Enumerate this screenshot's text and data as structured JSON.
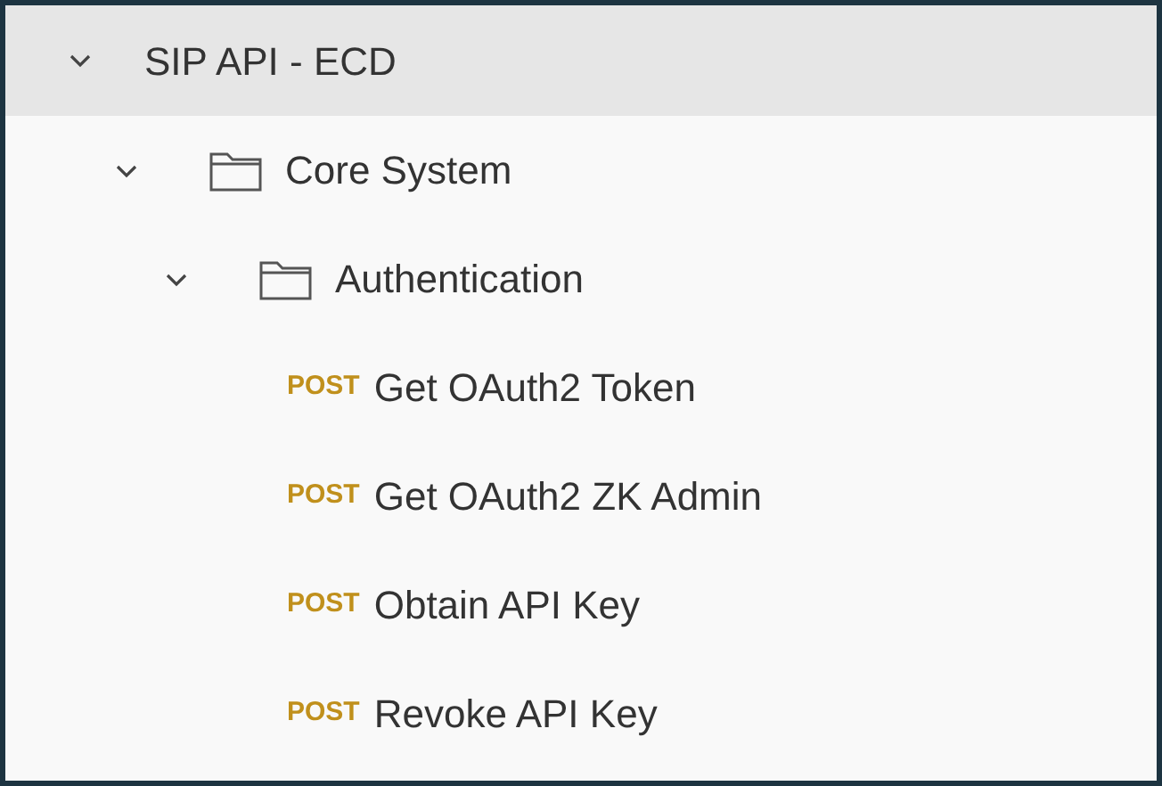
{
  "collection": {
    "name": "SIP API - ECD",
    "expanded": true,
    "selected": true,
    "children": [
      {
        "kind": "folder",
        "name": "Core System",
        "expanded": true,
        "children": [
          {
            "kind": "folder",
            "name": "Authentication",
            "expanded": true,
            "children": [
              {
                "kind": "request",
                "method": "POST",
                "name": "Get OAuth2 Token"
              },
              {
                "kind": "request",
                "method": "POST",
                "name": "Get OAuth2 ZK Admin"
              },
              {
                "kind": "request",
                "method": "POST",
                "name": "Obtain API Key"
              },
              {
                "kind": "request",
                "method": "POST",
                "name": "Revoke API Key"
              }
            ]
          }
        ]
      }
    ]
  }
}
